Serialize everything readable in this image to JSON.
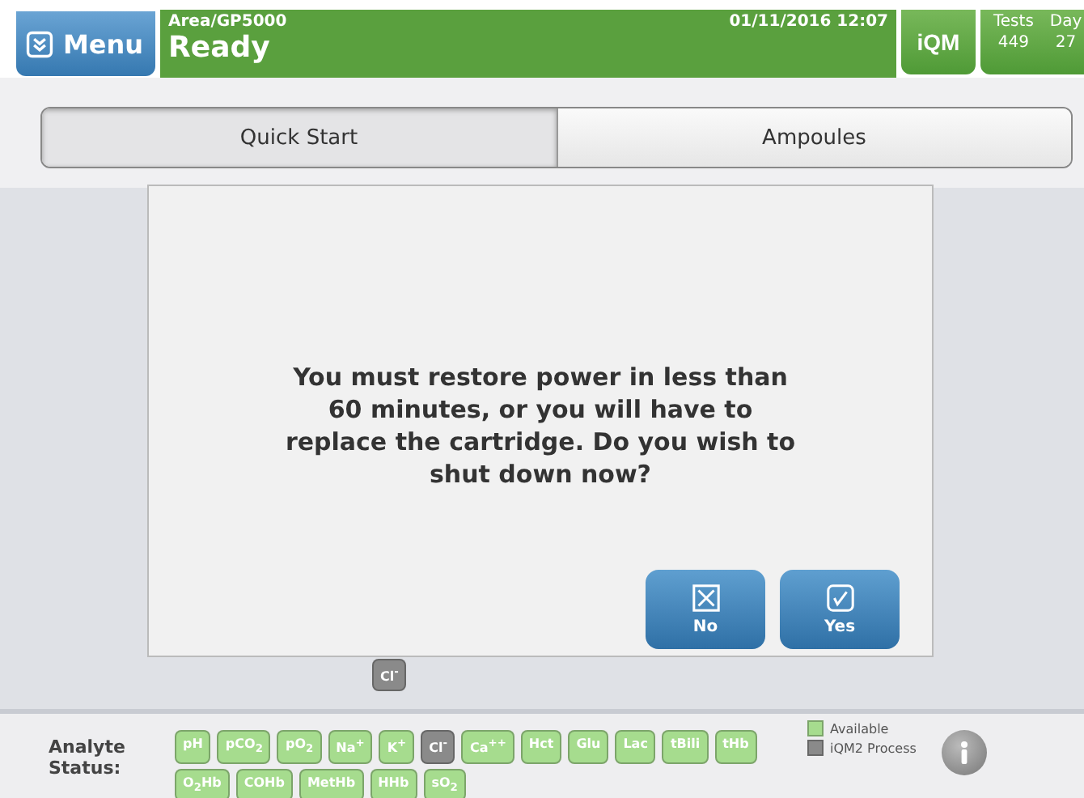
{
  "header": {
    "menu_label": "Menu",
    "location": "Area/GP5000",
    "status": "Ready",
    "datetime": "01/11/2016 12:07",
    "iqm_label": "iQM",
    "counters": [
      {
        "label": "Tests",
        "value": "449"
      },
      {
        "label": "Day",
        "value": "27"
      }
    ]
  },
  "tabs": [
    {
      "label": "Quick Start",
      "selected": true
    },
    {
      "label": "Ampoules",
      "selected": false
    }
  ],
  "dialog": {
    "message": "You must restore power in less than 60 minutes, or you will have to replace the cartridge. Do you wish to shut down now?",
    "buttons": [
      {
        "kind": "no",
        "label": "No"
      },
      {
        "kind": "yes",
        "label": "Yes"
      }
    ]
  },
  "floating_analyte": {
    "label": "Cl$^{-}$",
    "color": "#8a8a8a"
  },
  "analyte_status": {
    "label": "Analyte Status:",
    "analytes": [
      {
        "label": "pH",
        "color": "#a6dc8e"
      },
      {
        "label": "pCO$_{2}$",
        "color": "#a6dc8e"
      },
      {
        "label": "pO$_{2}$",
        "color": "#a6dc8e"
      },
      {
        "label": "Na$^{+}$",
        "color": "#a6dc8e"
      },
      {
        "label": "K$^{+}$",
        "color": "#a6dc8e"
      },
      {
        "label": "Cl$^{-}$",
        "color": "#8a8a8a"
      },
      {
        "label": "Ca$^{++}$",
        "color": "#a6dc8e"
      },
      {
        "label": "Hct",
        "color": "#a6dc8e"
      },
      {
        "label": "Glu",
        "color": "#a6dc8e"
      },
      {
        "label": "Lac",
        "color": "#a6dc8e"
      },
      {
        "label": "tBili",
        "color": "#a6dc8e"
      },
      {
        "label": "tHb",
        "color": "#a6dc8e"
      },
      {
        "label": "O$_{2}$Hb",
        "color": "#a6dc8e"
      },
      {
        "label": "COHb",
        "color": "#a6dc8e"
      },
      {
        "label": "MetHb",
        "color": "#a6dc8e"
      },
      {
        "label": "HHb",
        "color": "#a6dc8e"
      },
      {
        "label": "sO$_{2}$",
        "color": "#a6dc8e"
      }
    ],
    "legend": [
      {
        "label": "Available",
        "color": "#a6dc8e"
      },
      {
        "label": "iQM2 Process",
        "color": "#8a8a8a"
      }
    ]
  }
}
